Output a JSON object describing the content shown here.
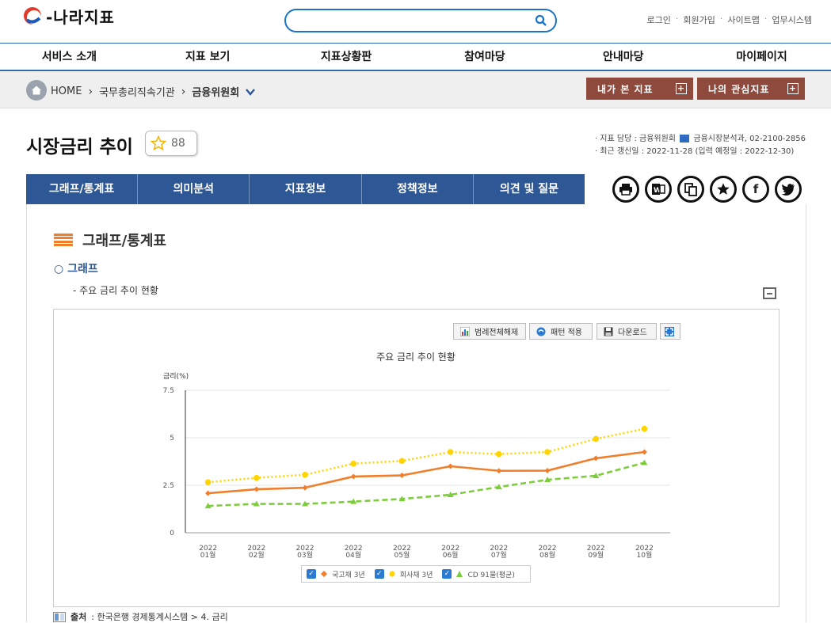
{
  "header": {
    "logo_text": "-나라지표",
    "search": {
      "placeholder": "",
      "value": ""
    },
    "util_links": [
      "로그인",
      "회원가입",
      "사이트맵",
      "업무시스템"
    ]
  },
  "gnb": [
    "서비스 소개",
    "지표 보기",
    "지표상황판",
    "참여마당",
    "안내마당",
    "마이페이지"
  ],
  "breadcrumb": {
    "home": "HOME",
    "level1": "국무총리직속기관",
    "level2": "금융위원회"
  },
  "my_buttons": {
    "viewed": "내가 본 지표",
    "interest": "나의 관심지표"
  },
  "page": {
    "title": "시장금리 추이",
    "star_count": "88",
    "meta_line1_prefix": "· 지표 담당 : 금융위원회",
    "meta_line1_suffix": "금융시장분석과, 02-2100-2856",
    "meta_line2": "· 최근 갱신일 : 2022-11-28 (입력 예정일 : 2022-12-30)"
  },
  "tabs": [
    "그래프/통계표",
    "의미분석",
    "지표정보",
    "정책정보",
    "의견 및 질문"
  ],
  "share_icons": [
    "print-icon",
    "word-icon",
    "copy-icon",
    "star-icon",
    "facebook-icon",
    "twitter-icon"
  ],
  "section": {
    "heading": "그래프/통계표",
    "subheading": "○ 그래프",
    "desc": "- 주요 금리 추이 현황"
  },
  "toolbar": {
    "legend_off": "범례전체해제",
    "pattern": "패턴 적용",
    "download": "다운로드"
  },
  "colors": {
    "nav": "#2d5795",
    "accent_brown": "#8d4a3d",
    "series1": "#f07f2c",
    "series2": "#ffd400",
    "series3": "#7dcc3c"
  },
  "source": {
    "label": "출처",
    "text": ": 한국은행 경제통계시스템 > 4. 금리"
  },
  "chart_data": {
    "type": "line",
    "title": "주요 금리 추이 현황",
    "ylabel": "금리(%)",
    "xlabel": "",
    "ylim": [
      0,
      7.5
    ],
    "yticks": [
      "7.5",
      "5",
      "2.5",
      "0"
    ],
    "categories": [
      [
        "2022",
        "01월"
      ],
      [
        "2022",
        "02월"
      ],
      [
        "2022",
        "03월"
      ],
      [
        "2022",
        "04월"
      ],
      [
        "2022",
        "05월"
      ],
      [
        "2022",
        "06월"
      ],
      [
        "2022",
        "07월"
      ],
      [
        "2022",
        "08월"
      ],
      [
        "2022",
        "09월"
      ],
      [
        "2022",
        "10월"
      ]
    ],
    "grid": true,
    "legend_position": "bottom",
    "series": [
      {
        "name": "국고채 3년",
        "color": "#f07f2c",
        "marker": "diamond",
        "style": "solid",
        "values": [
          2.08,
          2.29,
          2.37,
          2.96,
          3.02,
          3.5,
          3.26,
          3.27,
          3.92,
          4.25
        ]
      },
      {
        "name": "회사채 3년",
        "color": "#ffd400",
        "marker": "circle",
        "style": "dotted",
        "values": [
          2.66,
          2.89,
          3.05,
          3.64,
          3.78,
          4.25,
          4.14,
          4.25,
          4.94,
          5.47
        ]
      },
      {
        "name": "CD 91물(평균)",
        "color": "#7dcc3c",
        "marker": "triangle",
        "style": "dashed",
        "values": [
          1.41,
          1.52,
          1.52,
          1.64,
          1.78,
          2.0,
          2.41,
          2.79,
          3.0,
          3.69
        ]
      }
    ]
  }
}
